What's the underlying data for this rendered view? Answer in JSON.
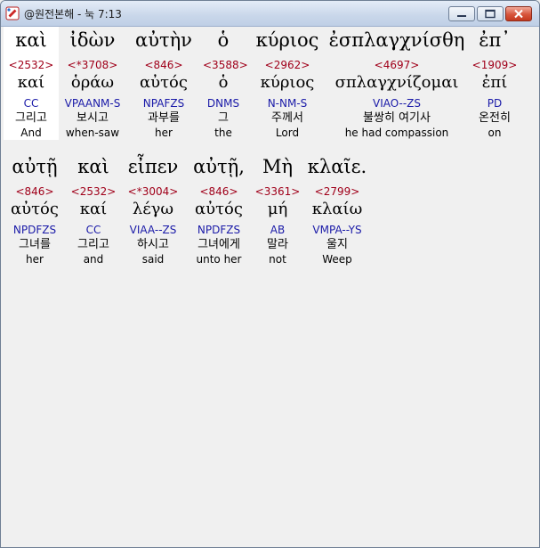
{
  "window": {
    "title": "@원전본해 - 눅 7:13",
    "icon": "scroll-app-icon"
  },
  "rows": [
    {
      "words": [
        {
          "greek": "καὶ",
          "strong": "<2532>",
          "lemma": "καί",
          "parsing": "CC",
          "korean": "그리고",
          "english": "And",
          "selected": true
        },
        {
          "greek": "ἰδὼν",
          "strong": "<*3708>",
          "lemma": "ὁράω",
          "parsing": "VPAANM-S",
          "korean": "보시고",
          "english": "when-saw"
        },
        {
          "greek": "αὐτὴν",
          "strong": "<846>",
          "lemma": "αὐτός",
          "parsing": "NPAFZS",
          "korean": "과부를",
          "english": "her"
        },
        {
          "greek": "ὁ",
          "strong": "<3588>",
          "lemma": "ὁ",
          "parsing": "DNMS",
          "korean": "그",
          "english": "the"
        },
        {
          "greek": "κύριος",
          "strong": "<2962>",
          "lemma": "κύριος",
          "parsing": "N-NM-S",
          "korean": "주께서",
          "english": "Lord"
        },
        {
          "greek": "ἐσπλαγχνίσθη",
          "strong": "<4697>",
          "lemma": "σπλαγχνίζομαι",
          "parsing": "VIAO--ZS",
          "korean": "불쌍히 여기사",
          "english": "he had compassion"
        },
        {
          "greek": "ἐπ᾽",
          "strong": "<1909>",
          "lemma": "ἐπί",
          "parsing": "PD",
          "korean": "온전히",
          "english": "on"
        }
      ]
    },
    {
      "words": [
        {
          "greek": "αὐτῇ",
          "strong": "<846>",
          "lemma": "αὐτός",
          "parsing": "NPDFZS",
          "korean": "그녀를",
          "english": "her"
        },
        {
          "greek": "καὶ",
          "strong": "<2532>",
          "lemma": "καί",
          "parsing": "CC",
          "korean": "그리고",
          "english": "and"
        },
        {
          "greek": "εἶπεν",
          "strong": "<*3004>",
          "lemma": "λέγω",
          "parsing": "VIAA--ZS",
          "korean": "하시고",
          "english": "said"
        },
        {
          "greek": "αὐτῇ,",
          "strong": "<846>",
          "lemma": "αὐτός",
          "parsing": "NPDFZS",
          "korean": "그녀에게",
          "english": "unto her"
        },
        {
          "greek": "Μὴ",
          "strong": "<3361>",
          "lemma": "μή",
          "parsing": "AB",
          "korean": "말라",
          "english": "not"
        },
        {
          "greek": "κλαῖε.",
          "strong": "<2799>",
          "lemma": "κλαίω",
          "parsing": "VMPA--YS",
          "korean": "울지",
          "english": "Weep"
        }
      ]
    }
  ],
  "colors": {
    "strong": "#a0001a",
    "parsing": "#1a1aa8",
    "text": "#000000",
    "background": "#f0f0f0",
    "selected": "#ffffff"
  }
}
